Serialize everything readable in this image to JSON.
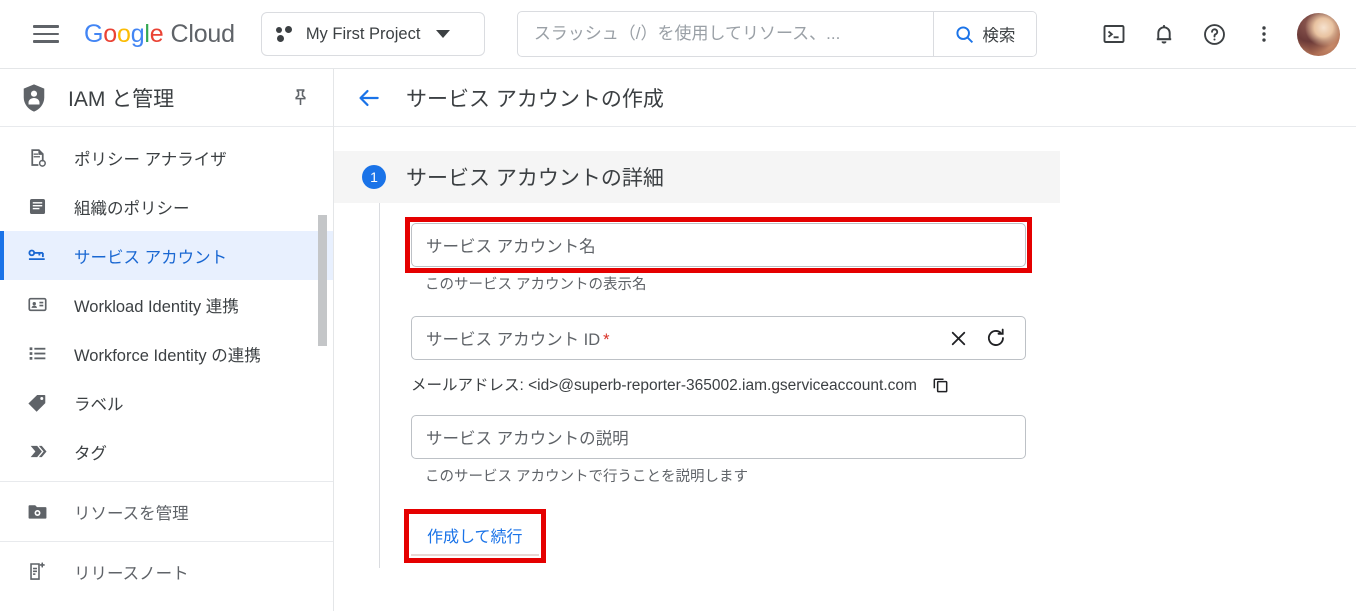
{
  "topbar": {
    "menu_icon": "hamburger-icon",
    "brand": {
      "g": "G",
      "o1": "o",
      "o2": "o",
      "g2": "g",
      "l": "l",
      "e": "e",
      "cloud": "Cloud"
    },
    "project": {
      "label": "My First Project",
      "icon": "project-dots-icon",
      "caret": "chevron-down-icon"
    },
    "search": {
      "placeholder": "スラッシュ（/）を使用してリソース、...",
      "value": "",
      "button_label": "検索",
      "button_icon": "search-icon"
    },
    "icons": [
      {
        "name": "cloud-shell-icon",
        "glyph": ">_"
      },
      {
        "name": "notifications-bell-icon",
        "glyph": "bell"
      },
      {
        "name": "help-icon",
        "glyph": "?"
      },
      {
        "name": "more-options-icon",
        "glyph": "kebab"
      }
    ],
    "avatar_name": "user-avatar"
  },
  "sidebar": {
    "header": {
      "title": "IAM と管理",
      "icon": "shield-person-icon",
      "pin_icon": "pin-icon"
    },
    "items": [
      {
        "label": "ポリシー アナライザ",
        "icon": "policy-analyzer-icon",
        "active": false,
        "muted": false
      },
      {
        "label": "組織のポリシー",
        "icon": "organization-policy-icon",
        "active": false,
        "muted": false
      },
      {
        "label": "サービス アカウント",
        "icon": "service-account-key-icon",
        "active": true,
        "muted": false
      },
      {
        "label": "Workload Identity 連携",
        "icon": "workload-identity-icon",
        "active": false,
        "muted": false
      },
      {
        "label": "Workforce Identity の連携",
        "icon": "workforce-identity-list-icon",
        "active": false,
        "muted": false
      },
      {
        "label": "ラベル",
        "icon": "label-tag-icon",
        "active": false,
        "muted": false
      },
      {
        "label": "タグ",
        "icon": "tag-arrow-icon",
        "active": false,
        "muted": false
      },
      {
        "label": "リソースを管理",
        "icon": "manage-resources-folder-icon",
        "active": false,
        "muted": true
      },
      {
        "label": "リリースノート",
        "icon": "release-notes-icon",
        "active": false,
        "muted": true
      }
    ]
  },
  "main": {
    "back_icon": "back-arrow-icon",
    "page_title": "サービス アカウントの作成",
    "step": {
      "number": "1",
      "title": "サービス アカウントの詳細"
    },
    "fields": {
      "name": {
        "placeholder": "サービス アカウント名",
        "value": "",
        "helper": "このサービス アカウントの表示名"
      },
      "id": {
        "placeholder": "サービス アカウント ID",
        "required_mark": "*",
        "value": "",
        "clear_icon": "clear-x-icon",
        "refresh_icon": "refresh-icon"
      },
      "email": {
        "text": "メールアドレス: <id>@superb-reporter-365002.iam.gserviceaccount.com",
        "copy_icon": "copy-icon"
      },
      "description": {
        "placeholder": "サービス アカウントの説明",
        "value": "",
        "helper": "このサービス アカウントで行うことを説明します"
      }
    },
    "create_button_label": "作成して続行"
  },
  "annotations": {
    "highlight_color": "#e50000",
    "boxes": [
      {
        "name": "highlight-service-account-name-field"
      },
      {
        "name": "highlight-create-and-continue-button"
      }
    ]
  },
  "colors": {
    "accent_blue": "#1a73e8",
    "active_bg": "#e8f0fe",
    "step_band": "#f5f5f5",
    "required_red": "#d93025",
    "highlight_red": "#e50000"
  }
}
